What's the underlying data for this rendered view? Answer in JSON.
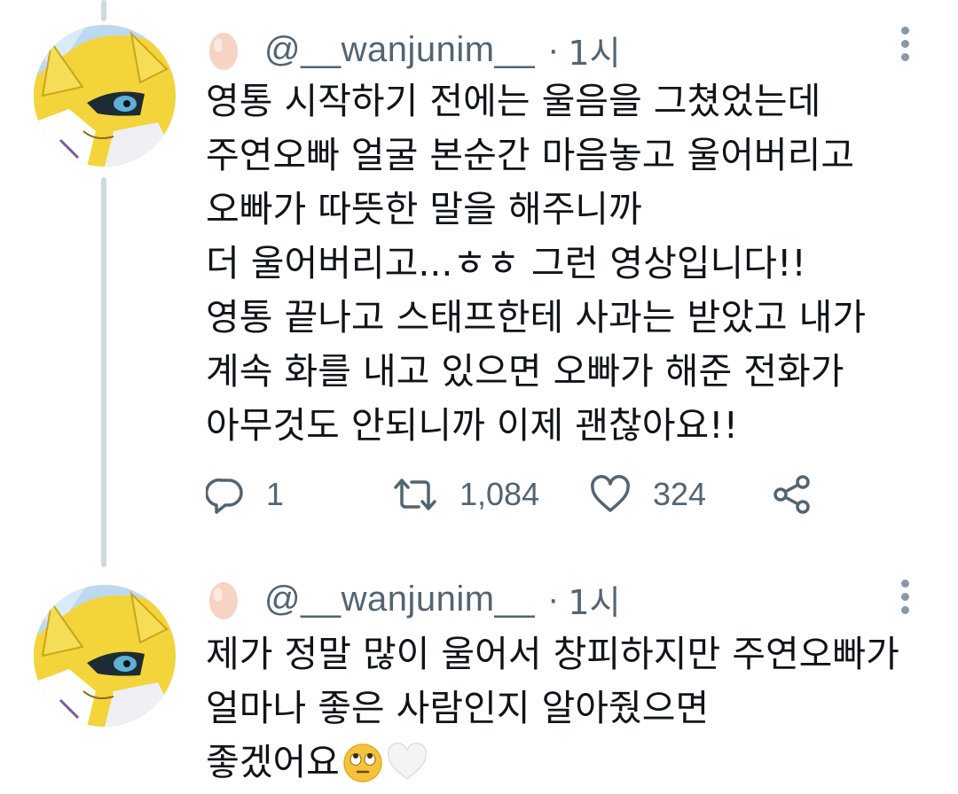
{
  "tweets": [
    {
      "handle": "@__wanjunim__",
      "separator": "·",
      "time": "1시",
      "lines": [
        "영통 시작하기 전에는 울음을  그쳤었는데",
        "주연오빠 얼굴 본순간 마음놓고 울어버리고",
        "오빠가 따뜻한 말을 해주니까",
        "더 울어버리고...ㅎㅎ 그런 영상입니다!!",
        "영통 끝나고 스태프한테 사과는 받았고 내가",
        "계속 화를 내고 있으면 오빠가 해준 전화가",
        "아무것도 안되니까 이제 괜찮아요!!"
      ],
      "actions": {
        "reply_count": "1",
        "retweet_count": "1,084",
        "like_count": "324"
      }
    },
    {
      "handle": "@__wanjunim__",
      "separator": "·",
      "time": "1시",
      "lines": [
        "제가 정말 많이 울어서 창피하지만 주연오빠가",
        "얼마나 좋은 사람인지 알아줬으면"
      ],
      "last_line": "좋겠어요",
      "last_line_emojis": [
        "face-with-rolling-eyes-emoji",
        "white-heart-emoji"
      ]
    }
  ],
  "colors": {
    "text": "#0f1419",
    "secondary": "#536471",
    "thread_line": "#cfd9de",
    "avatar_yellow": "#f3d43a"
  },
  "icons": [
    "egg-icon",
    "more-icon",
    "reply-icon",
    "retweet-icon",
    "like-icon",
    "share-icon"
  ]
}
